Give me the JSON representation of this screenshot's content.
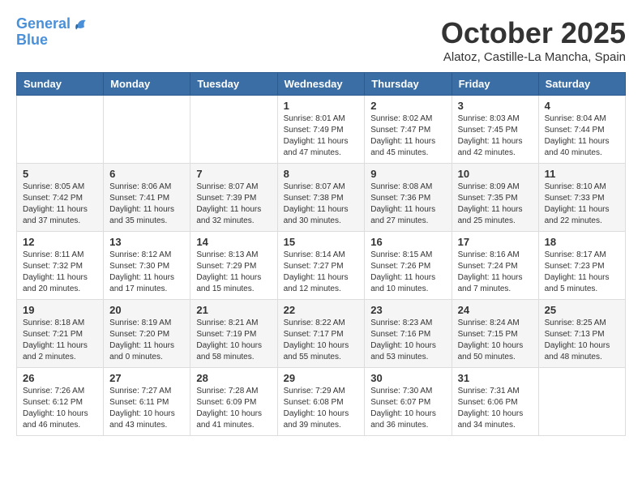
{
  "header": {
    "logo_line1": "General",
    "logo_line2": "Blue",
    "month": "October 2025",
    "location": "Alatoz, Castille-La Mancha, Spain"
  },
  "weekdays": [
    "Sunday",
    "Monday",
    "Tuesday",
    "Wednesday",
    "Thursday",
    "Friday",
    "Saturday"
  ],
  "weeks": [
    [
      {
        "day": "",
        "info": ""
      },
      {
        "day": "",
        "info": ""
      },
      {
        "day": "",
        "info": ""
      },
      {
        "day": "1",
        "info": "Sunrise: 8:01 AM\nSunset: 7:49 PM\nDaylight: 11 hours\nand 47 minutes."
      },
      {
        "day": "2",
        "info": "Sunrise: 8:02 AM\nSunset: 7:47 PM\nDaylight: 11 hours\nand 45 minutes."
      },
      {
        "day": "3",
        "info": "Sunrise: 8:03 AM\nSunset: 7:45 PM\nDaylight: 11 hours\nand 42 minutes."
      },
      {
        "day": "4",
        "info": "Sunrise: 8:04 AM\nSunset: 7:44 PM\nDaylight: 11 hours\nand 40 minutes."
      }
    ],
    [
      {
        "day": "5",
        "info": "Sunrise: 8:05 AM\nSunset: 7:42 PM\nDaylight: 11 hours\nand 37 minutes."
      },
      {
        "day": "6",
        "info": "Sunrise: 8:06 AM\nSunset: 7:41 PM\nDaylight: 11 hours\nand 35 minutes."
      },
      {
        "day": "7",
        "info": "Sunrise: 8:07 AM\nSunset: 7:39 PM\nDaylight: 11 hours\nand 32 minutes."
      },
      {
        "day": "8",
        "info": "Sunrise: 8:07 AM\nSunset: 7:38 PM\nDaylight: 11 hours\nand 30 minutes."
      },
      {
        "day": "9",
        "info": "Sunrise: 8:08 AM\nSunset: 7:36 PM\nDaylight: 11 hours\nand 27 minutes."
      },
      {
        "day": "10",
        "info": "Sunrise: 8:09 AM\nSunset: 7:35 PM\nDaylight: 11 hours\nand 25 minutes."
      },
      {
        "day": "11",
        "info": "Sunrise: 8:10 AM\nSunset: 7:33 PM\nDaylight: 11 hours\nand 22 minutes."
      }
    ],
    [
      {
        "day": "12",
        "info": "Sunrise: 8:11 AM\nSunset: 7:32 PM\nDaylight: 11 hours\nand 20 minutes."
      },
      {
        "day": "13",
        "info": "Sunrise: 8:12 AM\nSunset: 7:30 PM\nDaylight: 11 hours\nand 17 minutes."
      },
      {
        "day": "14",
        "info": "Sunrise: 8:13 AM\nSunset: 7:29 PM\nDaylight: 11 hours\nand 15 minutes."
      },
      {
        "day": "15",
        "info": "Sunrise: 8:14 AM\nSunset: 7:27 PM\nDaylight: 11 hours\nand 12 minutes."
      },
      {
        "day": "16",
        "info": "Sunrise: 8:15 AM\nSunset: 7:26 PM\nDaylight: 11 hours\nand 10 minutes."
      },
      {
        "day": "17",
        "info": "Sunrise: 8:16 AM\nSunset: 7:24 PM\nDaylight: 11 hours\nand 7 minutes."
      },
      {
        "day": "18",
        "info": "Sunrise: 8:17 AM\nSunset: 7:23 PM\nDaylight: 11 hours\nand 5 minutes."
      }
    ],
    [
      {
        "day": "19",
        "info": "Sunrise: 8:18 AM\nSunset: 7:21 PM\nDaylight: 11 hours\nand 2 minutes."
      },
      {
        "day": "20",
        "info": "Sunrise: 8:19 AM\nSunset: 7:20 PM\nDaylight: 11 hours\nand 0 minutes."
      },
      {
        "day": "21",
        "info": "Sunrise: 8:21 AM\nSunset: 7:19 PM\nDaylight: 10 hours\nand 58 minutes."
      },
      {
        "day": "22",
        "info": "Sunrise: 8:22 AM\nSunset: 7:17 PM\nDaylight: 10 hours\nand 55 minutes."
      },
      {
        "day": "23",
        "info": "Sunrise: 8:23 AM\nSunset: 7:16 PM\nDaylight: 10 hours\nand 53 minutes."
      },
      {
        "day": "24",
        "info": "Sunrise: 8:24 AM\nSunset: 7:15 PM\nDaylight: 10 hours\nand 50 minutes."
      },
      {
        "day": "25",
        "info": "Sunrise: 8:25 AM\nSunset: 7:13 PM\nDaylight: 10 hours\nand 48 minutes."
      }
    ],
    [
      {
        "day": "26",
        "info": "Sunrise: 7:26 AM\nSunset: 6:12 PM\nDaylight: 10 hours\nand 46 minutes."
      },
      {
        "day": "27",
        "info": "Sunrise: 7:27 AM\nSunset: 6:11 PM\nDaylight: 10 hours\nand 43 minutes."
      },
      {
        "day": "28",
        "info": "Sunrise: 7:28 AM\nSunset: 6:09 PM\nDaylight: 10 hours\nand 41 minutes."
      },
      {
        "day": "29",
        "info": "Sunrise: 7:29 AM\nSunset: 6:08 PM\nDaylight: 10 hours\nand 39 minutes."
      },
      {
        "day": "30",
        "info": "Sunrise: 7:30 AM\nSunset: 6:07 PM\nDaylight: 10 hours\nand 36 minutes."
      },
      {
        "day": "31",
        "info": "Sunrise: 7:31 AM\nSunset: 6:06 PM\nDaylight: 10 hours\nand 34 minutes."
      },
      {
        "day": "",
        "info": ""
      }
    ]
  ]
}
